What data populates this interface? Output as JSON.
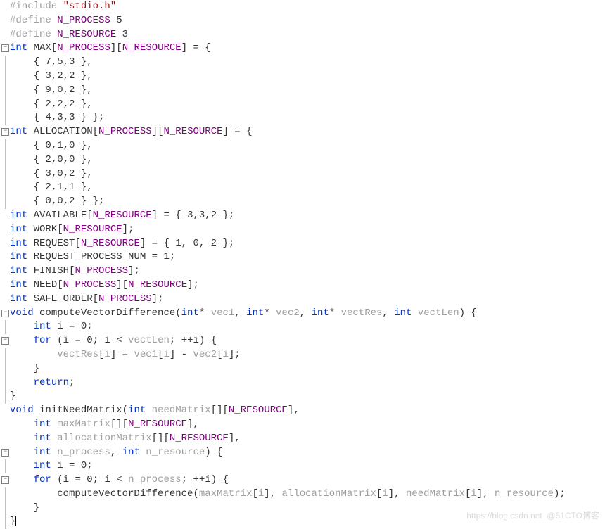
{
  "watermark_left": "https://blog.csdn.net",
  "watermark_right": "@51CTO博客",
  "tokens": {
    "include": "#include",
    "define": "#define",
    "stdio": "\"stdio.h\"",
    "N_PROCESS": "N_PROCESS",
    "N_RESOURCE": "N_RESOURCE",
    "five": "5",
    "three": "3",
    "int": "int",
    "void": "void",
    "for": "for",
    "return": "return",
    "MAX": "MAX",
    "ALLOCATION": "ALLOCATION",
    "AVAILABLE": "AVAILABLE",
    "WORK": "WORK",
    "REQUEST": "REQUEST",
    "REQUEST_PROCESS_NUM": "REQUEST_PROCESS_NUM",
    "FINISH": "FINISH",
    "NEED": "NEED",
    "SAFE_ORDER": "SAFE_ORDER",
    "computeVectorDifference": "computeVectorDifference",
    "initNeedMatrix": "initNeedMatrix",
    "vec1": "vec1",
    "vec2": "vec2",
    "vectRes": "vectRes",
    "vectLen": "vectLen",
    "needMatrix": "needMatrix",
    "maxMatrix": "maxMatrix",
    "allocationMatrix": "allocationMatrix",
    "n_process": "n_process",
    "n_resource": "n_resource",
    "i": "i",
    "eq0": " = 0;",
    "eq1": " = 1;",
    "zero": "0",
    "row_753": "{ 7,5,3 },",
    "row_322": "{ 3,2,2 },",
    "row_902": "{ 9,0,2 },",
    "row_222": "{ 2,2,2 },",
    "row_433_end": "{ 4,3,3 } };",
    "row_010": "{ 0,1,0 },",
    "row_200": "{ 2,0,0 },",
    "row_302": "{ 3,0,2 },",
    "row_211": "{ 2,1,1 },",
    "row_002_end": "{ 0,0,2 } };",
    "avail_init": " = { 3,3,2 };",
    "req_init": " = { 1, 0, 2 };",
    "open_brace": " = {",
    "close_tail": "] = {",
    "semi": ";",
    "star": "*",
    "comma_sp": ", ",
    "open_paren": "(",
    "close_paren": ")",
    "open_curly": " {",
    "close_curly": "}",
    "brL": "[",
    "brR": "]",
    "bracket_open_close": "[][",
    "lt": "<",
    "inc": "; ++",
    "assign_diff": "] = ",
    "minus": " - ",
    "line_body_assign": "vectRes[i] = vec1[i] - vec2[i];",
    "call_cvd": "computeVectorDifference(maxMatrix[i], allocationMatrix[i], needMatrix[i], n_resource);"
  }
}
